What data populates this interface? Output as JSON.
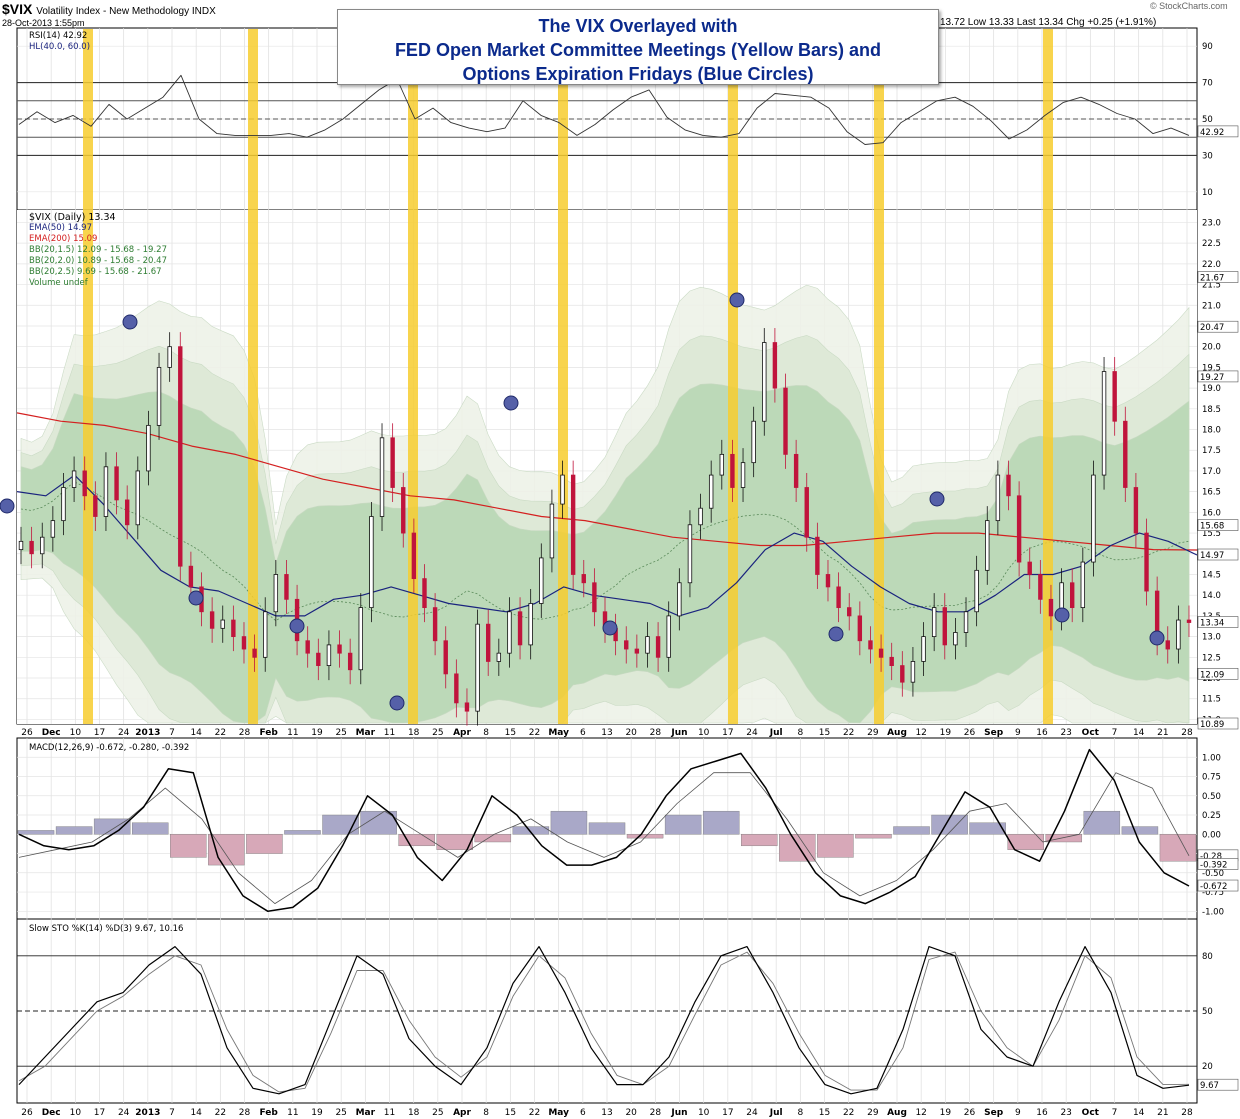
{
  "header": {
    "symbol": "$VIX",
    "name": "Volatility Index - New Methodology  INDX",
    "date": "28-Oct-2013 1:55pm",
    "quote": "13.72  Low 13.33  Last 13.34  Chg +0.25 (+1.91%)",
    "watermark": "© StockCharts.com"
  },
  "annotation": {
    "line1": "The VIX Overlayed with",
    "line2": "FED Open Market Committee Meetings (Yellow Bars) and",
    "line3": "Options Expiration Fridays (Blue Circles)"
  },
  "legends": {
    "rsi": "RSI(14) 42.92",
    "hl": "HL(40.0, 60.0)",
    "vix": "$VIX (Daily) 13.34",
    "ema50": "EMA(50) 14.97",
    "ema200": "EMA(200) 15.09",
    "bb15": "BB(20,1.5) 12.09 - 15.68 - 19.27",
    "bb20": "BB(20,2.0) 10.89 - 15.68 - 20.47",
    "bb25": "BB(20,2.5) 9.69 - 15.68 - 21.67",
    "volume": "Volume undef",
    "macd": "MACD(12,26,9) -0.672, -0.280, -0.392",
    "sto": "Slow STO %K(14) %D(3) 9.67, 10.16"
  },
  "colors": {
    "fomc": "#f7cc2e",
    "opex": "#5560a8",
    "up_candle": "#111111",
    "down_candle": "#c0143c",
    "ema50": "#1a237e",
    "ema200": "#d42020",
    "band": "#9cc79c",
    "title": "#0b2a8c"
  },
  "chart_data": [
    {
      "type": "line",
      "panel": "RSI(14)",
      "yticks": [
        10,
        30,
        50,
        70,
        90
      ],
      "ylim": [
        0,
        100
      ],
      "reference_lines": [
        30,
        40,
        50,
        60,
        70
      ],
      "last_value": 42.92,
      "series": [
        {
          "name": "RSI(14)",
          "values": [
            47,
            54,
            48,
            52,
            46,
            58,
            50,
            56,
            62,
            74,
            50,
            42,
            41,
            41,
            41,
            42,
            40,
            44,
            50,
            58,
            66,
            72,
            50,
            56,
            48,
            45,
            43,
            45,
            60,
            52,
            48,
            41,
            47,
            55,
            62,
            66,
            51,
            44,
            41,
            40,
            42,
            56,
            64,
            63,
            62,
            56,
            43,
            36,
            37,
            48,
            54,
            60,
            62,
            57,
            49,
            39,
            44,
            52,
            59,
            62,
            58,
            53,
            50,
            42,
            45,
            41
          ]
        }
      ]
    },
    {
      "type": "candlestick",
      "panel": "$VIX (Daily)",
      "ylim": [
        10.89,
        23.3
      ],
      "yticks": [
        11.0,
        11.5,
        12.0,
        12.5,
        13.0,
        13.5,
        14.0,
        14.5,
        15.0,
        15.5,
        16.0,
        16.5,
        17.0,
        17.5,
        18.0,
        18.5,
        19.0,
        19.5,
        20.0,
        20.5,
        21.0,
        21.5,
        22.0,
        22.5,
        23.0
      ],
      "price_labels": [
        21.67,
        20.47,
        19.27,
        15.68,
        14.97,
        13.34,
        12.09,
        10.89
      ],
      "last": 13.34,
      "close": [
        15.3,
        15.0,
        15.4,
        15.8,
        16.6,
        17.0,
        16.4,
        15.9,
        17.1,
        16.3,
        15.7,
        17.0,
        18.1,
        19.5,
        20.0,
        14.7,
        14.2,
        13.6,
        13.2,
        13.4,
        13.0,
        12.7,
        12.5,
        13.6,
        14.5,
        13.9,
        12.9,
        12.6,
        12.3,
        12.8,
        12.6,
        12.2,
        13.7,
        15.9,
        17.8,
        16.6,
        15.5,
        14.4,
        13.7,
        12.9,
        12.1,
        11.4,
        11.2,
        13.3,
        12.4,
        12.6,
        13.6,
        12.8,
        13.8,
        14.9,
        16.2,
        16.9,
        14.5,
        14.3,
        13.6,
        13.2,
        12.9,
        12.7,
        12.6,
        13.0,
        12.5,
        13.5,
        14.3,
        15.7,
        16.1,
        16.9,
        17.4,
        16.6,
        17.2,
        18.2,
        20.1,
        19.0,
        17.4,
        16.6,
        15.4,
        14.5,
        14.2,
        13.7,
        13.5,
        12.9,
        12.7,
        12.5,
        12.3,
        11.9,
        12.4,
        13.0,
        13.7,
        12.8,
        13.1,
        13.6,
        14.6,
        15.8,
        16.9,
        16.4,
        14.8,
        14.5,
        13.9,
        13.5,
        14.3,
        13.7,
        14.8,
        16.9,
        19.4,
        18.2,
        16.6,
        15.5,
        14.1,
        12.9,
        12.7,
        13.4,
        13.34
      ],
      "fomc_bars": [
        "Dec 12",
        "Jan 30",
        "Mar 20",
        "May 1",
        "Jun 19",
        "Jul 31",
        "Sep 18"
      ],
      "opex_fridays": [
        "Nov 16",
        "Dec 21",
        "Jan 18",
        "Feb 15",
        "Mar 15",
        "Apr 19",
        "May 17",
        "Jun 21",
        "Jul 19",
        "Aug 16",
        "Sep 20",
        "Oct 18"
      ],
      "series": [
        {
          "name": "EMA(50)",
          "last": 14.97,
          "values": [
            16.5,
            16.4,
            16.9,
            16.2,
            15.4,
            14.6,
            14.2,
            14.1,
            13.8,
            13.5,
            13.5,
            13.9,
            14.0,
            14.2,
            14.0,
            13.8,
            13.7,
            13.6,
            13.8,
            14.2,
            14.0,
            13.9,
            13.8,
            13.5,
            13.7,
            14.3,
            15.1,
            15.5,
            15.3,
            14.7,
            14.2,
            13.8,
            13.6,
            13.6,
            14.0,
            14.5,
            14.5,
            14.7,
            15.2,
            15.5,
            15.3,
            14.97
          ]
        },
        {
          "name": "EMA(200)",
          "last": 15.09,
          "values": [
            18.4,
            18.2,
            18.1,
            17.9,
            17.6,
            17.4,
            17.1,
            16.8,
            16.6,
            16.4,
            16.3,
            16.1,
            15.9,
            15.8,
            15.6,
            15.4,
            15.3,
            15.2,
            15.2,
            15.3,
            15.4,
            15.5,
            15.5,
            15.4,
            15.3,
            15.2,
            15.1,
            15.09
          ]
        }
      ]
    },
    {
      "type": "line",
      "panel": "MACD(12,26,9)",
      "ylim": [
        -1.1,
        1.25
      ],
      "yticks": [
        -1.0,
        -0.75,
        -0.5,
        -0.25,
        0.0,
        0.25,
        0.5,
        0.75,
        1.0
      ],
      "price_labels": [
        -0.28,
        -0.392,
        -0.672
      ],
      "series": [
        {
          "name": "MACD",
          "last": -0.672,
          "values": [
            0.0,
            -0.15,
            -0.2,
            -0.15,
            0.05,
            0.35,
            0.85,
            0.8,
            -0.3,
            -0.8,
            -1.0,
            -0.95,
            -0.7,
            -0.15,
            0.5,
            0.25,
            -0.3,
            -0.6,
            -0.2,
            0.5,
            0.25,
            -0.15,
            -0.4,
            -0.4,
            -0.3,
            0.0,
            0.5,
            0.85,
            0.95,
            1.05,
            0.6,
            0.0,
            -0.5,
            -0.8,
            -0.9,
            -0.75,
            -0.55,
            0.0,
            0.55,
            0.35,
            -0.2,
            -0.35,
            0.3,
            1.1,
            0.7,
            -0.1,
            -0.5,
            -0.672
          ]
        },
        {
          "name": "Signal",
          "last": -0.28,
          "values": [
            -0.3,
            -0.2,
            -0.1,
            0.2,
            0.6,
            0.2,
            -0.5,
            -0.9,
            -0.6,
            0.0,
            0.3,
            0.0,
            -0.3,
            0.0,
            0.2,
            -0.1,
            -0.3,
            -0.1,
            0.4,
            0.8,
            0.8,
            0.2,
            -0.5,
            -0.8,
            -0.6,
            -0.2,
            0.3,
            0.4,
            -0.1,
            0.0,
            0.8,
            0.6,
            -0.28
          ]
        },
        {
          "name": "Histogram",
          "last": -0.392,
          "values": [
            0.05,
            0.1,
            0.2,
            0.15,
            -0.3,
            -0.4,
            -0.25,
            0.05,
            0.25,
            0.3,
            -0.15,
            -0.2,
            -0.1,
            0.1,
            0.3,
            0.15,
            -0.05,
            0.25,
            0.3,
            -0.15,
            -0.35,
            -0.3,
            -0.05,
            0.1,
            0.25,
            0.15,
            -0.2,
            -0.1,
            0.3,
            0.1,
            -0.35
          ]
        }
      ]
    },
    {
      "type": "line",
      "panel": "Slow STO %K(14) %D(3)",
      "ylim": [
        0,
        100
      ],
      "yticks": [
        20,
        50,
        80
      ],
      "price_labels": [
        9.67
      ],
      "series": [
        {
          "name": "%K",
          "last": 9.67,
          "values": [
            10,
            25,
            40,
            55,
            60,
            75,
            85,
            70,
            30,
            8,
            5,
            10,
            45,
            80,
            70,
            35,
            20,
            10,
            30,
            65,
            85,
            60,
            30,
            10,
            10,
            25,
            55,
            80,
            85,
            60,
            30,
            10,
            5,
            8,
            40,
            85,
            80,
            40,
            25,
            20,
            55,
            85,
            60,
            15,
            8,
            9.67
          ]
        },
        {
          "name": "%D",
          "last": 10.16,
          "values": [
            12,
            20,
            35,
            50,
            58,
            70,
            80,
            75,
            40,
            15,
            6,
            8,
            38,
            72,
            72,
            45,
            25,
            14,
            25,
            58,
            80,
            68,
            38,
            15,
            10,
            20,
            48,
            75,
            82,
            65,
            38,
            15,
            7,
            7,
            30,
            78,
            82,
            50,
            30,
            20,
            45,
            80,
            68,
            25,
            10,
            10.16
          ]
        }
      ]
    }
  ],
  "x_axis_labels": [
    "26",
    "Dec",
    "10",
    "17",
    "24",
    "2013",
    "7",
    "14",
    "22",
    "28",
    "Feb",
    "11",
    "19",
    "25",
    "Mar",
    "11",
    "18",
    "25",
    "Apr",
    "8",
    "15",
    "22",
    "May",
    "6",
    "13",
    "20",
    "28",
    "Jun",
    "10",
    "17",
    "24",
    "Jul",
    "8",
    "15",
    "22",
    "29",
    "Aug",
    "12",
    "19",
    "26",
    "Sep",
    "9",
    "16",
    "23",
    "Oct",
    "7",
    "14",
    "21",
    "28"
  ]
}
